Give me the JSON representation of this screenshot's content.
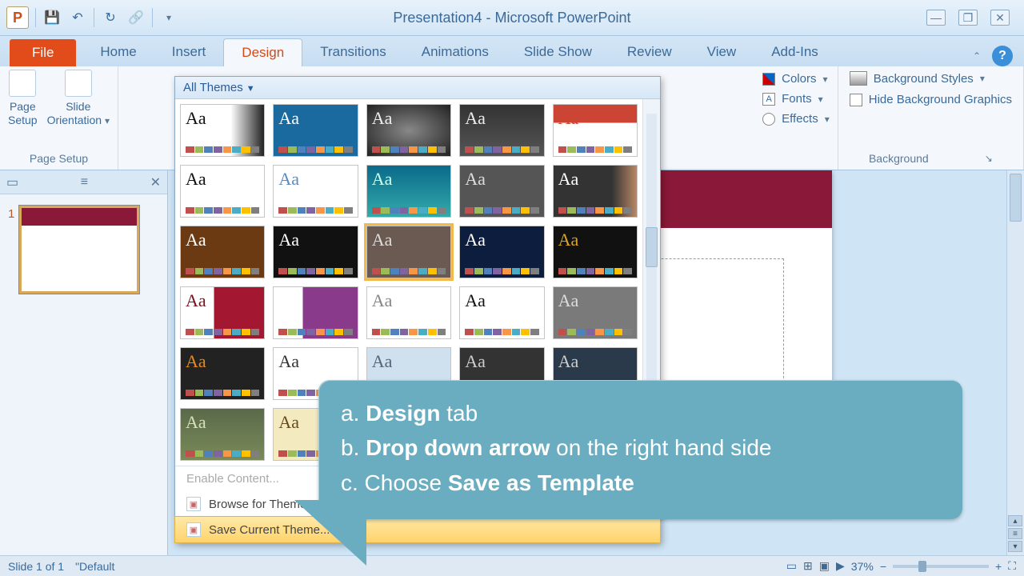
{
  "title": "Presentation4  -  Microsoft PowerPoint",
  "app_letter": "P",
  "tabs": {
    "file": "File",
    "items": [
      "Home",
      "Insert",
      "Design",
      "Transitions",
      "Animations",
      "Slide Show",
      "Review",
      "View",
      "Add-Ins"
    ],
    "active_index": 2
  },
  "ribbon": {
    "page_setup_group": "Page Setup",
    "page_setup_btn": "Page\nSetup",
    "slide_orientation_btn": "Slide\nOrientation",
    "colors": "Colors",
    "fonts": "Fonts",
    "effects": "Effects",
    "bg_styles": "Background Styles",
    "hide_bg": "Hide Background Graphics",
    "bg_group": "Background"
  },
  "thumbs": {
    "slide_num": "1"
  },
  "gallery": {
    "header": "All Themes",
    "enable": "Enable Content...",
    "browse": "Browse for Themes...",
    "save": "Save Current Theme...",
    "themes": [
      {
        "bg": "#ffffff",
        "fg": "#111",
        "grad": "linear-gradient(90deg,#fff 60%,#222)"
      },
      {
        "bg": "#1a6aa0",
        "fg": "#fff",
        "grad": "#1a6aa0"
      },
      {
        "bg": "#222",
        "fg": "#eee",
        "grad": "radial-gradient(#888,#222)"
      },
      {
        "bg": "#333",
        "fg": "#eee",
        "grad": "linear-gradient(#333,#555)"
      },
      {
        "bg": "#fff",
        "fg": "#c43",
        "grad": "linear-gradient(#c43 35%,#fff 35%)"
      },
      {
        "bg": "#fff",
        "fg": "#111",
        "grad": "#fff"
      },
      {
        "bg": "#fff",
        "fg": "#5a8bc4",
        "grad": "#fff"
      },
      {
        "bg": "#0a6a8a",
        "fg": "#cfe",
        "grad": "linear-gradient(#0a6a8a,#3aa)"
      },
      {
        "bg": "#555",
        "fg": "#ddd",
        "grad": "#555"
      },
      {
        "bg": "#333",
        "fg": "#fff",
        "grad": "linear-gradient(90deg,#333 70%,#b86)"
      },
      {
        "bg": "#6b3a12",
        "fg": "#fff",
        "grad": "#6b3a12"
      },
      {
        "bg": "#111",
        "fg": "#fff",
        "grad": "#111"
      },
      {
        "bg": "#6a5a52",
        "fg": "#ddd",
        "grad": "#6a5a52"
      },
      {
        "bg": "#0d1d3d",
        "fg": "#fff",
        "grad": "#0d1d3d"
      },
      {
        "bg": "#111",
        "fg": "#d9a421",
        "grad": "#111"
      },
      {
        "bg": "#fff",
        "fg": "#7a1020",
        "grad": "linear-gradient(90deg,#fff 40%,#a31830 40%)"
      },
      {
        "bg": "#8a3a8a",
        "fg": "#fff",
        "grad": "linear-gradient(90deg,#fff 35%,#8a3a8a 35%)"
      },
      {
        "bg": "#fff",
        "fg": "#888",
        "grad": "#fff"
      },
      {
        "bg": "#fff",
        "fg": "#111",
        "grad": "#fff"
      },
      {
        "bg": "#7a7a7a",
        "fg": "#ddd",
        "grad": "#7a7a7a"
      },
      {
        "bg": "#222",
        "fg": "#e88a1a",
        "grad": "#222"
      },
      {
        "bg": "#fff",
        "fg": "#333",
        "grad": "#fff"
      },
      {
        "bg": "#cfe1ef",
        "fg": "#567",
        "grad": "#cfe1ef"
      },
      {
        "bg": "#333",
        "fg": "#ccc",
        "grad": "#333"
      },
      {
        "bg": "#2a3a4a",
        "fg": "#ccc",
        "grad": "#2a3a4a"
      },
      {
        "bg": "#5a6a4a",
        "fg": "#d8e0b8",
        "grad": "linear-gradient(#5a6a4a,#7a8a5a)"
      },
      {
        "bg": "#f3eac0",
        "fg": "#6b4a1a",
        "grad": "#f3eac0"
      }
    ],
    "swatch_colors": [
      "#c0504d",
      "#9bbb59",
      "#4f81bd",
      "#8064a2",
      "#f79646",
      "#4bacc6",
      "#ffc000",
      "#7f7f7f"
    ]
  },
  "callout": {
    "a_pre": "a. ",
    "a_b": "Design",
    "a_post": " tab",
    "b_pre": "b. ",
    "b_b": "Drop down arrow",
    "b_post": " on the right hand side",
    "c_pre": "c. Choose ",
    "c_b": "Save as Template",
    "c_post": ""
  },
  "status": {
    "slide": "Slide 1 of 1",
    "theme": "\"Default",
    "zoom": "37%"
  }
}
